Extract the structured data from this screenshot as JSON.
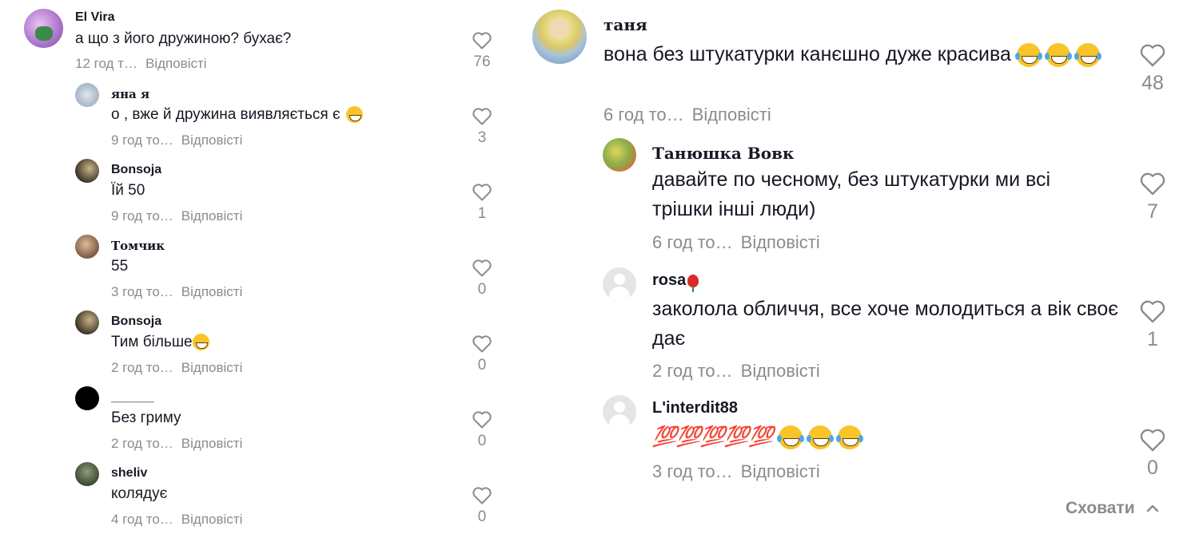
{
  "reply_label": "Відповісті",
  "hide_label": "Сховати",
  "left": [
    {
      "user": "El Vira",
      "text": "а що з його дружиною? бухає?",
      "time": "12 год т…",
      "likes": "76"
    },
    {
      "user": "яна я",
      "text": "о , вже й дружина виявляється є",
      "time": "9 год то…",
      "likes": "3"
    },
    {
      "user": "Bonsoja",
      "text": "Їй 50",
      "time": "9 год то…",
      "likes": "1"
    },
    {
      "user": "Томчик",
      "text": "55",
      "time": "3 год то…",
      "likes": "0"
    },
    {
      "user": "Bonsoja",
      "text": "Тим більше",
      "time": "2 год то…",
      "likes": "0"
    },
    {
      "user": "______",
      "text": "Без гриму",
      "time": "2 год то…",
      "likes": "0"
    },
    {
      "user": "sheliv",
      "text": "колядує",
      "time": "4 год то…",
      "likes": "0"
    }
  ],
  "right": [
    {
      "user": "таня",
      "text": "вона без штукатурки канєшно дуже красива",
      "time": "6 год то…",
      "likes": "48"
    },
    {
      "user": "Танюшка Вовк",
      "text": "давайте по чесному, без штукатурки ми всі трішки інші люди)",
      "time": "6 год то…",
      "likes": "7"
    },
    {
      "user": "rosa",
      "text": "заколола обличчя, все хоче молодиться а вік своє дає",
      "time": "2 год то…",
      "likes": "1"
    },
    {
      "user": "L'interdit88",
      "text": "💯💯💯💯💯",
      "time": "3 год то…",
      "likes": "0"
    }
  ],
  "colors": {
    "text": "#161823",
    "muted": "#8a8b91",
    "emoji": "#f7c42a"
  },
  "icons": [
    "heart-icon",
    "chevron-up-icon",
    "rose-emoji",
    "grinning-sweat-emoji",
    "tears-of-joy-emoji",
    "hundred-points-emoji"
  ]
}
